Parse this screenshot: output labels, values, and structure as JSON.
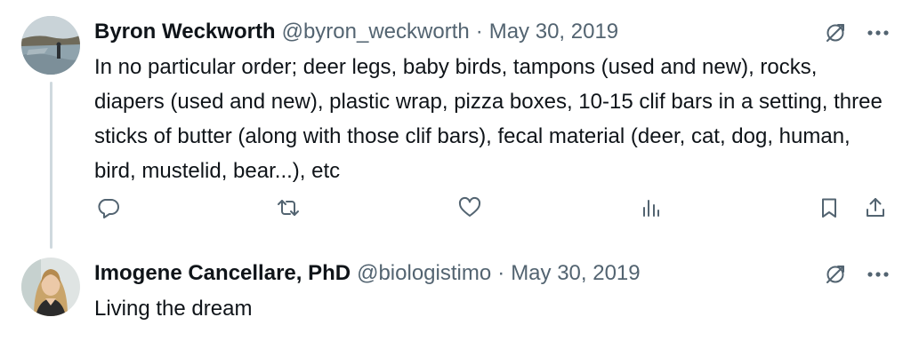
{
  "tweets": [
    {
      "name": "Byron Weckworth",
      "handle": "@byron_weckworth",
      "separator": "·",
      "date": "May 30, 2019",
      "text": "In no particular order; deer legs, baby birds, tampons (used and new), rocks, diapers (used and new), plastic wrap, pizza boxes, 10-15 clif bars in a setting, three sticks of butter (along with those clif bars), fecal material (deer, cat, dog, human, bird, mustelid, bear...), etc",
      "icons": {
        "grok": "grok-icon",
        "more": "more-icon",
        "reply": "reply-icon",
        "retweet": "retweet-icon",
        "like": "heart-icon",
        "views": "analytics-icon",
        "bookmark": "bookmark-icon",
        "share": "share-icon"
      }
    },
    {
      "name": "Imogene Cancellare, PhD",
      "handle": "@biologistimo",
      "separator": "·",
      "date": "May 30, 2019",
      "text": "Living the dream",
      "icons": {
        "grok": "grok-icon",
        "more": "more-icon"
      }
    }
  ],
  "colors": {
    "text": "#0f1419",
    "secondary": "#536471",
    "thread_line": "#cfd9de",
    "background": "#ffffff"
  }
}
